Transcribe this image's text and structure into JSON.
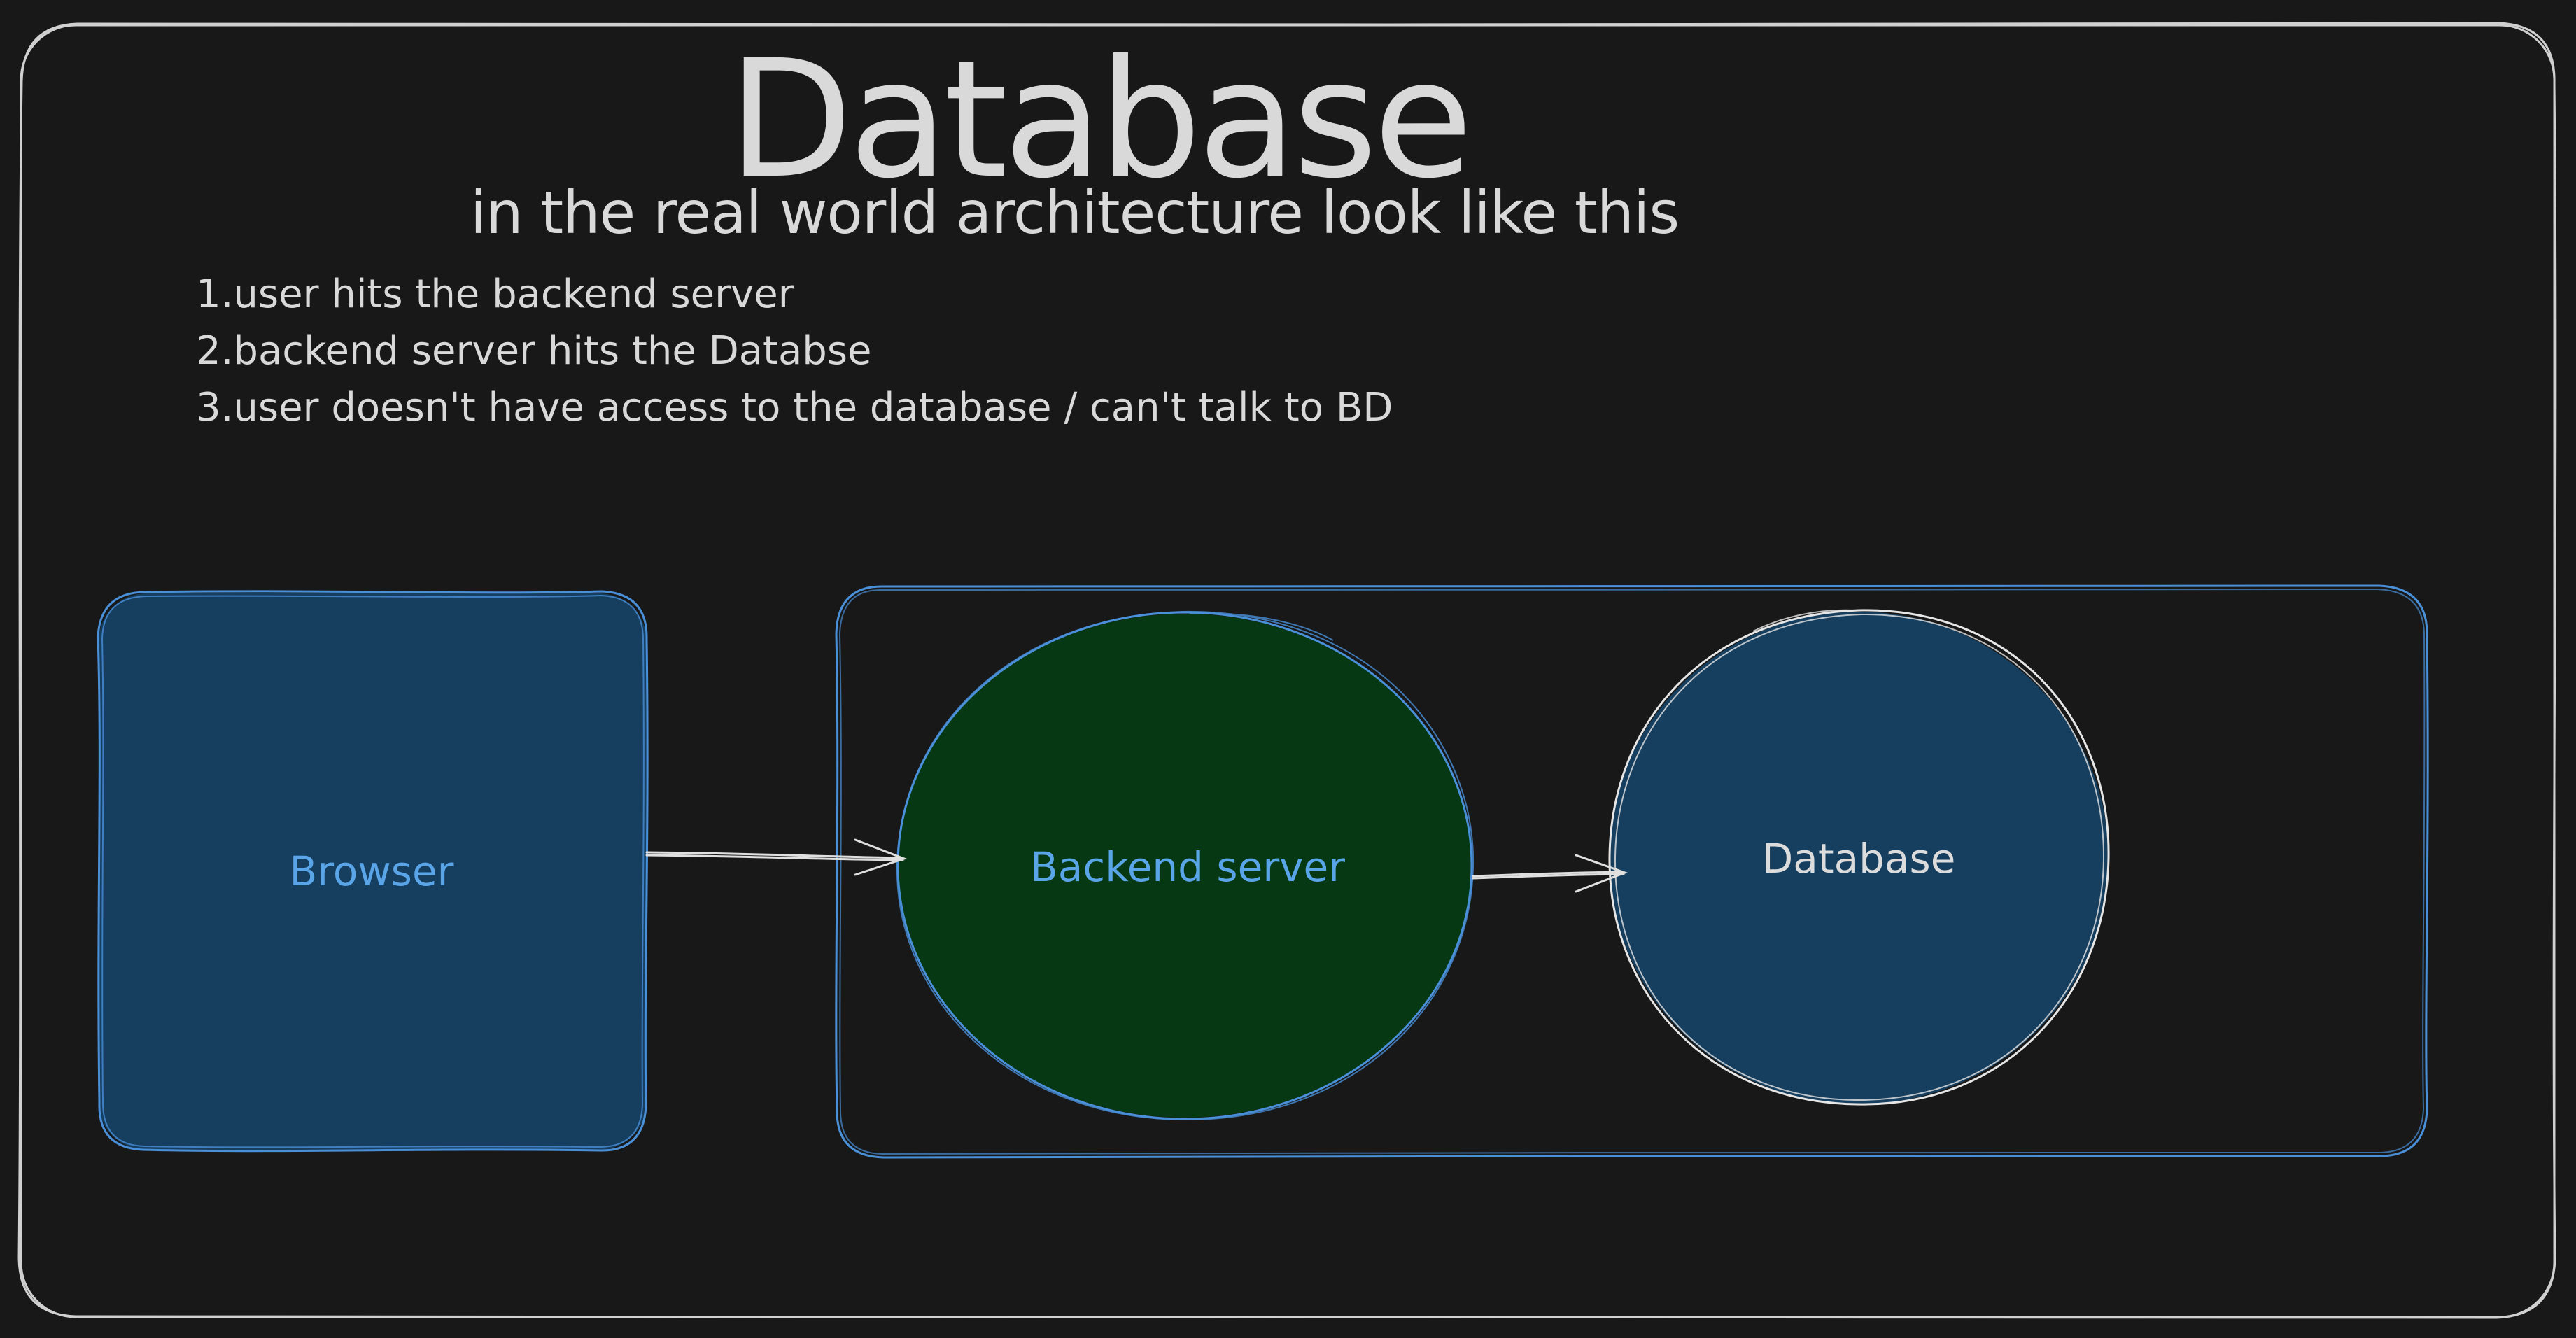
{
  "diagram": {
    "title": "Database",
    "subtitle": "in the real world architecture look like this",
    "notes": [
      "1.user hits the backend server",
      "2.backend server hits the Databse",
      "3.user doesn't have access to the database / can't talk to BD"
    ],
    "nodes": {
      "browser": "Browser",
      "backend": "Backend server",
      "database": "Database"
    }
  },
  "colors": {
    "background": "#181818",
    "frame_stroke": "#d0d0d0",
    "text": "#d9d9d9",
    "browser_fill": "#163e5e",
    "accent_blue": "#4a90d9",
    "backend_fill": "#053813",
    "database_fill": "#163e5e",
    "arrow": "#e0e0e0"
  }
}
